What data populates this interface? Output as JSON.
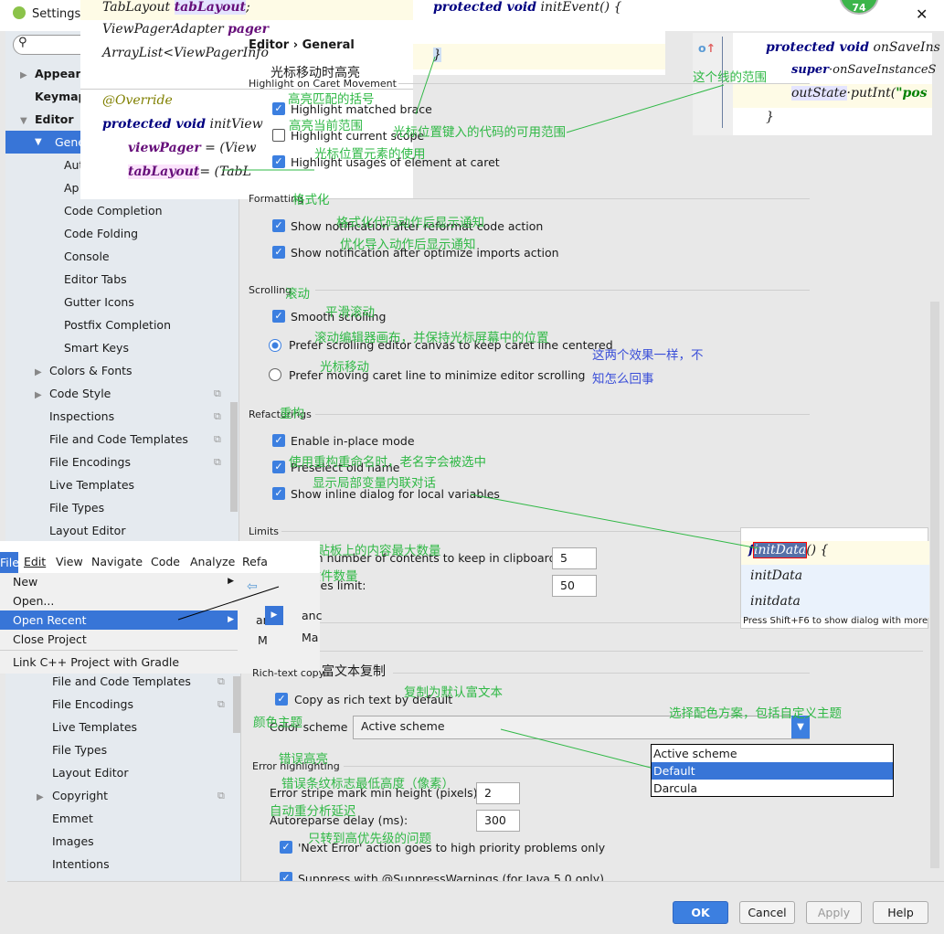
{
  "window": {
    "title": "Settings",
    "badge": "74",
    "close": "✕"
  },
  "search": {
    "placeholder": ""
  },
  "sidebar": {
    "items": [
      "Appearance",
      "Keymap",
      "Editor",
      "General",
      "Auto",
      "Ap",
      "Code Completion",
      "Code Folding",
      "Console",
      "Editor Tabs",
      "Gutter Icons",
      "Postfix Completion",
      "Smart Keys",
      "Colors & Fonts",
      "Code Style",
      "Inspections",
      "File and Code Templates",
      "File Encodings",
      "Live Templates",
      "File Types",
      "Layout Editor"
    ]
  },
  "sidebar2": {
    "items": [
      "File and Code Templates",
      "File Encodings",
      "Live Templates",
      "File Types",
      "Layout Editor",
      "Copyright",
      "Emmet",
      "Images",
      "Intentions"
    ]
  },
  "breadcrumb": {
    "parent": "Editor",
    "sep": "›",
    "current": "General"
  },
  "code1": {
    "l1a": "TabLayout",
    "l1b": "tabLayout",
    "l1c": ";",
    "l2a": "ViewPagerAdapter",
    "l2b": "pager",
    "l3": "ArrayList<ViewPagerInfo",
    "l4": "@Override",
    "l5a": "protected void",
    "l5b": "initView",
    "l6a": "viewPager",
    "l6b": "= (View",
    "l7a": "tabLayout",
    "l7b": "= (TabL"
  },
  "code2": {
    "l1a": "protected void",
    "l1b": "initEvent() {",
    "l2": "}"
  },
  "code3": {
    "l1a": "protected void",
    "l1b": "onSaveIns",
    "l2a": "super",
    "l2b": "·onSaveInstanceS",
    "l3a": "outState",
    "l3b": "·putInt(",
    "l3c": "\"pos",
    "l4": "}"
  },
  "sections": {
    "caret": {
      "title": "Highlight on Caret Movement",
      "items": [
        "Highlight matched brace",
        "Highlight current scope",
        "Highlight usages of element at caret"
      ],
      "checked": [
        true,
        false,
        true
      ]
    },
    "formatting": {
      "title": "Formatting",
      "items": [
        "Show notification after reformat code action",
        "Show notification after optimize imports action"
      ],
      "checked": [
        true,
        true
      ]
    },
    "scrolling": {
      "title": "Scrolling",
      "smooth": "Smooth scrolling",
      "opt1": "Prefer scrolling editor canvas to keep caret line centered",
      "opt2": "Prefer moving caret line to minimize editor scrolling",
      "selected": "opt1"
    },
    "refactorings": {
      "title": "Refactorings",
      "items": [
        "Enable in-place mode",
        "Preselect old name",
        "Show inline dialog for local variables"
      ],
      "checked": [
        true,
        true,
        true
      ]
    },
    "limits": {
      "title": "Limits",
      "clip_label": "Maximum number of contents to keep in clipboard:",
      "clip_value": "5",
      "recent_label": "Recent files limit:",
      "recent_value": "50"
    },
    "richtext": {
      "title": "Rich-text copy",
      "copy": "Copy as rich text by default",
      "scheme_label": "Color scheme",
      "scheme_value": "Active scheme",
      "options": [
        "Active scheme",
        "Default",
        "Darcula"
      ],
      "highlighted": "Default"
    },
    "error": {
      "title": "Error highlighting",
      "stripe_label": "Error stripe mark min height (pixels):",
      "stripe_value": "2",
      "delay_label": "Autoreparse delay (ms):",
      "delay_value": "300",
      "next_error": "'Next Error' action goes to high priority problems only",
      "suppress": "Suppress with @SuppressWarnings (for Java 5.0 only)"
    }
  },
  "rename_popup": {
    "word": "initData",
    "rest": "() {",
    "s1": "initData",
    "s2": "initdata",
    "hint": "Press Shift+F6 to show dialog with more o"
  },
  "menu": {
    "bar": [
      "File",
      "Edit",
      "View",
      "Navigate",
      "Code",
      "Analyze",
      "Refa"
    ],
    "items": [
      "New",
      "Open...",
      "Open Recent",
      "Close Project",
      "Link C++ Project with Gradle"
    ],
    "sub": [
      "an",
      "M"
    ],
    "sub2": [
      "anc",
      "Ma"
    ]
  },
  "annotations": {
    "caret": "光标移动时高亮",
    "brace": "高亮匹配的括号",
    "scope": "高亮当前范围",
    "scope_range": "光标位置键入的代码的可用范围",
    "usages": "光标位置元素的使用",
    "line_range": "这个线的范围",
    "formatting": "格式化",
    "reformat": "格式化代码动作后显示通知",
    "optimize": "优化导入动作后显示通知",
    "scrolling": "滚动",
    "smooth": "平滑滚动",
    "centered": "滚动编辑器画布，并保持光标屏幕中的位置",
    "moving": "光标移动",
    "same1": "这两个效果一样，不",
    "same2": "知怎么回事",
    "refactor": "重构",
    "preselect": "使用重构重命名时，老名字会被选中",
    "inline": "显示局部变量内联对话",
    "clip": "保持剪贴板上的内容最大数量",
    "recent": "最近的文件数量",
    "rich": "富文本复制",
    "richdefault": "复制为默认富文本",
    "scheme": "颜色主题",
    "scheme_choose": "选择配色方案，包括自定义主题",
    "err": "错误高亮",
    "stripe": "错误条纹标志最低高度（像素）",
    "delay": "自动重分析延迟",
    "nexterr": "只转到高优先级的问题"
  },
  "buttons": {
    "ok": "OK",
    "cancel": "Cancel",
    "apply": "Apply",
    "help": "Help"
  },
  "colors": {
    "accent": "#3875d7",
    "annotation": "#2fb845",
    "annotation_blue": "#3b4fd8",
    "badge": "#3cb54a"
  }
}
